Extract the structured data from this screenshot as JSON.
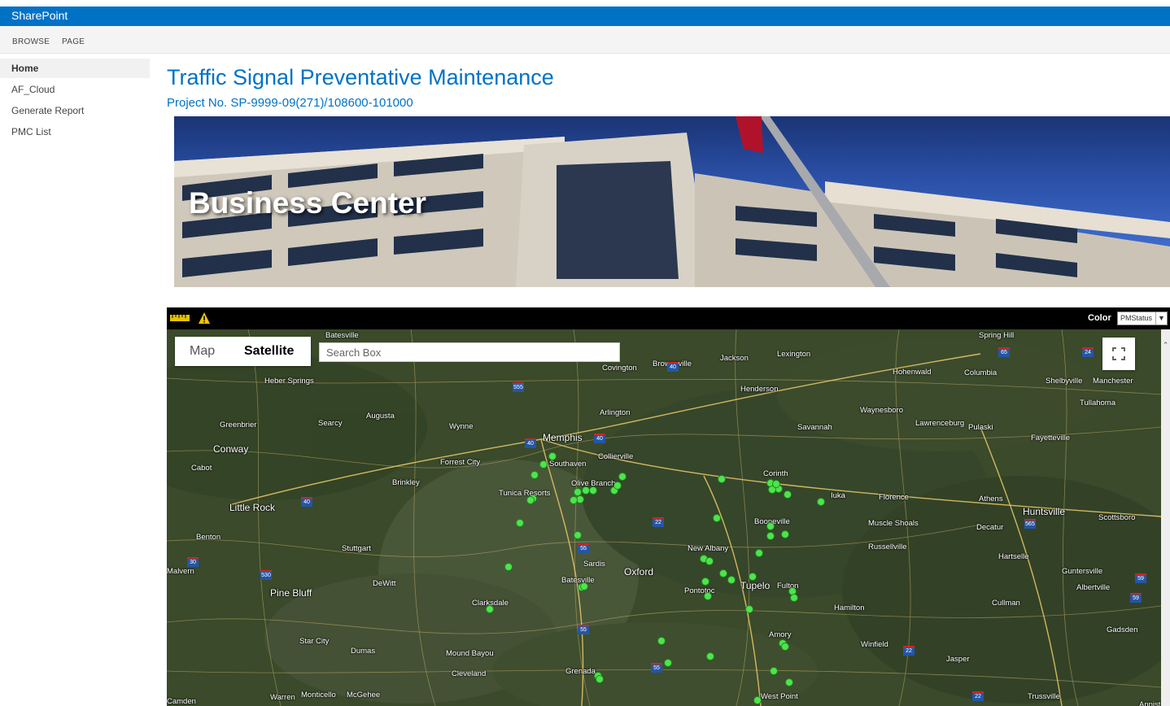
{
  "suite": {
    "brand": "SharePoint"
  },
  "ribbon": {
    "tabs": [
      "BROWSE",
      "PAGE"
    ]
  },
  "nav": {
    "items": [
      "Home",
      "AF_Cloud",
      "Generate Report",
      "PMC List"
    ],
    "selected": 0
  },
  "page": {
    "title": "Traffic Signal Preventative Maintenance",
    "subtitle": "Project No. SP-9999-09(271)/108600-101000"
  },
  "banner": {
    "text": "Business Center"
  },
  "map": {
    "toolbar": {
      "ruler_icon": "ruler-icon",
      "warning_icon": "warning-icon",
      "color_label": "Color",
      "color_select_value": "PMStatus"
    },
    "type_buttons": {
      "map": "Map",
      "satellite": "Satellite",
      "selected": "Satellite"
    },
    "search": {
      "placeholder": "Search Box",
      "value": ""
    },
    "fullscreen_icon": "fullscreen-icon",
    "labels": [
      "Batesville",
      "Spring Hill",
      "Jackson",
      "Lexington",
      "Brownsville",
      "Covington",
      "Heber Springs",
      "Hohenwald",
      "Columbia",
      "Shelbyville",
      "Manchester",
      "Tullahoma",
      "Henderson",
      "Waynesboro",
      "Lawrenceburg",
      "Pulaski",
      "Greenbrier",
      "Searcy",
      "Augusta",
      "Wynne",
      "Arlington",
      "Savannah",
      "Fayetteville",
      "Conway",
      "Memphis",
      "Collierville",
      "Cabot",
      "Southaven",
      "Forrest City",
      "Corinth",
      "Brinkley",
      "Olive Branch",
      "Tunica Resorts",
      "Iuka",
      "Florence",
      "Athens",
      "Huntsville",
      "Little Rock",
      "Booneville",
      "Muscle Shoals",
      "Decatur",
      "Scottsboro",
      "Benton",
      "Stuttgart",
      "New Albany",
      "Russellville",
      "Hartselle",
      "Sardis",
      "Malvern",
      "DeWitt",
      "Batesville",
      "Oxford",
      "Tupelo",
      "Fulton",
      "Guntersville",
      "Albertville",
      "Pine Bluff",
      "Pontotoc",
      "Clarksdale",
      "Hamilton",
      "Cullman",
      "Amory",
      "Star City",
      "Dumas",
      "Mound Bayou",
      "Winfield",
      "Jasper",
      "Gadsden",
      "Cleveland",
      "Grenada",
      "Warren",
      "Monticello",
      "McGehee",
      "West Point",
      "Trussville",
      "Anniston",
      "Camden"
    ],
    "highway_shields": [
      "65",
      "24",
      "40",
      "555",
      "40",
      "40",
      "40",
      "22",
      "55",
      "530",
      "30",
      "55",
      "22",
      "22",
      "59",
      "59",
      "565",
      "55"
    ],
    "markers": 59
  }
}
